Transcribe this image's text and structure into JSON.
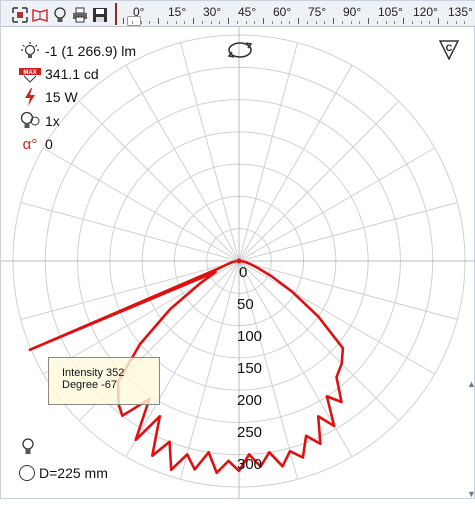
{
  "toolbar": {
    "icons": [
      "expand-icon",
      "book-icon",
      "bulb-icon",
      "print-icon",
      "save-icon"
    ],
    "angle_labels": [
      "0°",
      "15°",
      "30°",
      "45°",
      "60°",
      "75°",
      "90°",
      "105°",
      "120°",
      "135°"
    ]
  },
  "info": {
    "lumen": "-1 (1 266.9) lm",
    "candela": "341.1 cd",
    "watt": "15 W",
    "count": "1x",
    "alpha": "0"
  },
  "radial_labels": [
    "0",
    "50",
    "100",
    "150",
    "200",
    "250",
    "300"
  ],
  "tooltip": {
    "line1": "Intensity 352",
    "line2": "Degree -67"
  },
  "diameter_label": "D=225 mm",
  "corner_label": "C",
  "colors": {
    "curve": "#dd1111",
    "grid": "#d0d0d0",
    "accent": "#cc2222"
  },
  "chart_data": {
    "type": "line",
    "title": "",
    "polar": true,
    "radial_ticks": [
      0,
      50,
      100,
      150,
      200,
      250,
      300
    ],
    "angle_step_deg": 15,
    "series": [
      {
        "points": [
          [
            -90,
            4
          ],
          [
            -80,
            10
          ],
          [
            -75,
            18
          ],
          [
            -70,
            33
          ],
          [
            -67,
            352
          ],
          [
            -65,
            40
          ],
          [
            -60,
            70
          ],
          [
            -55,
            130
          ],
          [
            -50,
            200
          ],
          [
            -45,
            265
          ],
          [
            -40,
            290
          ],
          [
            -37,
            300
          ],
          [
            -33,
            255
          ],
          [
            -30,
            320
          ],
          [
            -27,
            270
          ],
          [
            -24,
            330
          ],
          [
            -21,
            300
          ],
          [
            -18,
            340
          ],
          [
            -15,
            310
          ],
          [
            -12,
            330
          ],
          [
            -9,
            300
          ],
          [
            -6,
            330
          ],
          [
            -3,
            310
          ],
          [
            0,
            325
          ],
          [
            3,
            300
          ],
          [
            6,
            320
          ],
          [
            9,
            300
          ],
          [
            12,
            325
          ],
          [
            15,
            305
          ],
          [
            18,
            320
          ],
          [
            21,
            290
          ],
          [
            24,
            310
          ],
          [
            27,
            270
          ],
          [
            30,
            295
          ],
          [
            33,
            250
          ],
          [
            36,
            270
          ],
          [
            40,
            235
          ],
          [
            45,
            225
          ],
          [
            50,
            210
          ],
          [
            55,
            150
          ],
          [
            60,
            95
          ],
          [
            65,
            55
          ],
          [
            70,
            30
          ],
          [
            75,
            18
          ],
          [
            80,
            10
          ],
          [
            90,
            4
          ]
        ]
      }
    ]
  }
}
